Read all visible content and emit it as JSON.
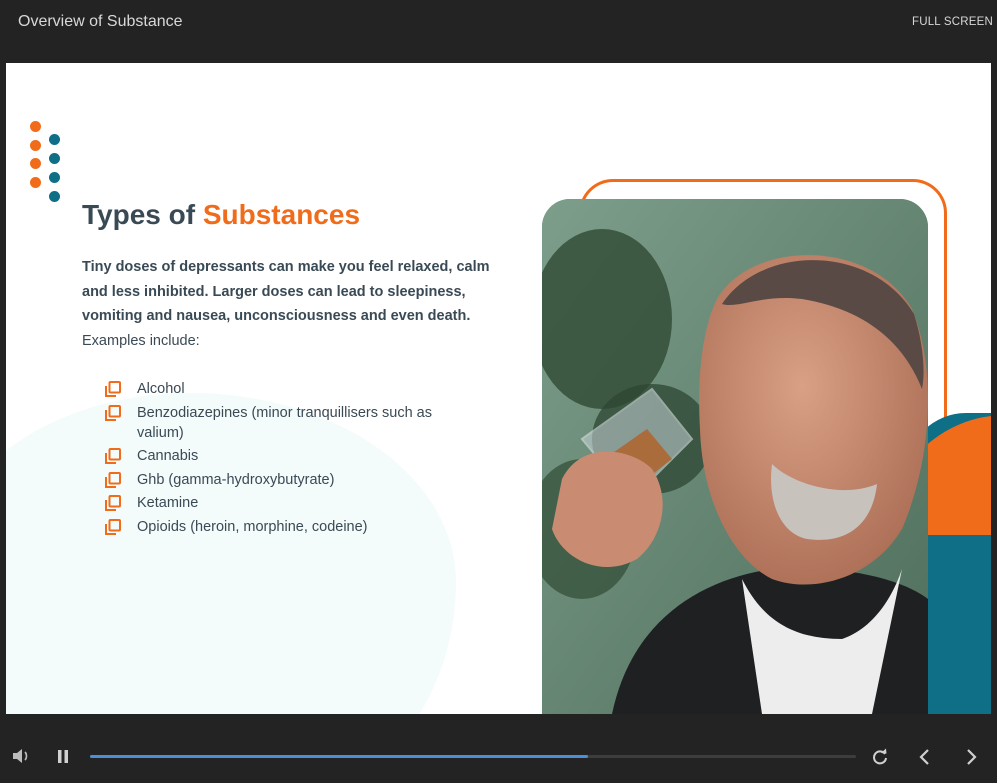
{
  "header": {
    "title": "Overview of Substance",
    "fullscreen_label": "FULL SCREEN"
  },
  "slide": {
    "heading_prefix": "Types of ",
    "heading_accent": "Substances",
    "intro_bold": "Tiny doses of depressants can make you feel relaxed, calm and less inhibited. Larger doses can lead to sleepiness, vomiting and nausea, unconsciousness and even death.",
    "intro_regular": "Examples include:",
    "examples": [
      "Alcohol",
      "Benzodiazepines (minor tranquillisers such as valium)",
      "Cannabis",
      "Ghb (gamma-hydroxybutyrate)",
      "Ketamine",
      "Opioids (heroin, morphine, codeine)"
    ],
    "bullet_icon": "copy-icon",
    "photo": "man-drinking-whisky-photo"
  },
  "player": {
    "progress": 0.65,
    "icons": {
      "volume": "volume-icon",
      "pause": "pause-icon",
      "replay": "replay-icon",
      "previous": "chevron-left-icon",
      "next": "chevron-right-icon"
    }
  },
  "colors": {
    "accent_orange": "#f06c1a",
    "accent_teal": "#0f6f86",
    "text_dark": "#3a4a55",
    "chrome": "#232323",
    "progress": "#4a90d9"
  }
}
